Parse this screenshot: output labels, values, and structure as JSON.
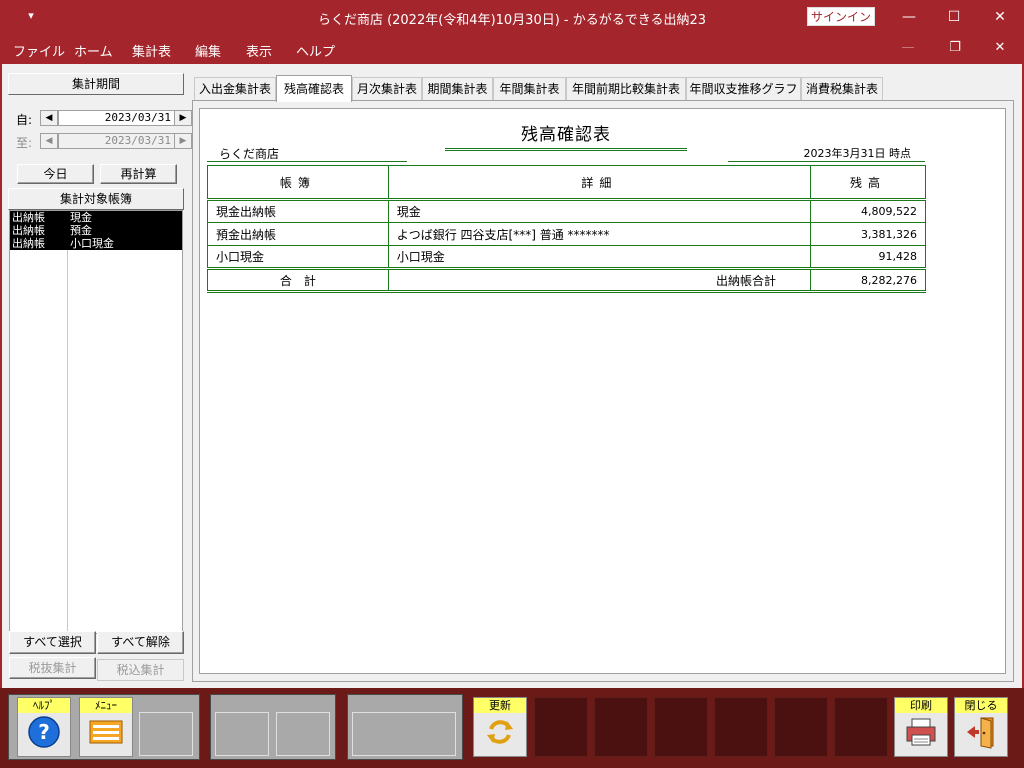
{
  "window": {
    "title": "らくだ商店 (2022年(令和4年)10月30日)  -  かるがるできる出納23",
    "signin_label": "サインイン",
    "minimize_icon": "—",
    "maximize_icon": "☐",
    "close_icon": "✕"
  },
  "menu": {
    "items": [
      "ファイル",
      "ホーム",
      "集計表",
      "編集",
      "表示",
      "ヘルプ"
    ],
    "mdi_min": "—",
    "mdi_restore": "❐",
    "mdi_close": "✕"
  },
  "left_panel": {
    "period_label": "集計期間",
    "from_label": "自:",
    "from_date": "2023/03/31",
    "to_label": "至:",
    "to_date": "2023/03/31",
    "today_button": "今日",
    "recalc_button": "再計算",
    "target_books_label": "集計対象帳簿",
    "books": [
      {
        "type": "出納帳",
        "name": "現金"
      },
      {
        "type": "出納帳",
        "name": "預金"
      },
      {
        "type": "出納帳",
        "name": "小口現金"
      }
    ],
    "select_all_button": "すべて選択",
    "deselect_all_button": "すべて解除",
    "tax_excluded_button": "税抜集計",
    "tax_included_button": "税込集計"
  },
  "tabs": [
    {
      "label": "入出金集計表",
      "active": false
    },
    {
      "label": "残高確認表",
      "active": true
    },
    {
      "label": "月次集計表",
      "active": false
    },
    {
      "label": "期間集計表",
      "active": false
    },
    {
      "label": "年間集計表",
      "active": false
    },
    {
      "label": "年間前期比較集計表",
      "active": false
    },
    {
      "label": "年間収支推移グラフ",
      "active": false
    },
    {
      "label": "消費税集計表",
      "active": false
    }
  ],
  "report": {
    "title": "残高確認表",
    "shop_name": "らくだ商店",
    "as_of": "2023年3月31日 時点",
    "headers": {
      "book": "帳簿",
      "detail": "詳細",
      "balance": "残高"
    },
    "rows": [
      {
        "book": "現金出納帳",
        "detail": "現金",
        "balance": "4,809,522"
      },
      {
        "book": "預金出納帳",
        "detail": "よつば銀行 四谷支店[***] 普通 *******",
        "balance": "3,381,326"
      },
      {
        "book": "小口現金",
        "detail": "小口現金",
        "balance": "91,428"
      }
    ],
    "total": {
      "label": "合　計",
      "detail": "出納帳合計",
      "balance": "8,282,276"
    }
  },
  "toolbar": {
    "help_label": "ﾍﾙﾌﾟ",
    "menu_label": "ﾒﾆｭｰ",
    "refresh_label": "更新",
    "print_label": "印刷",
    "close_label": "閉じる"
  }
}
